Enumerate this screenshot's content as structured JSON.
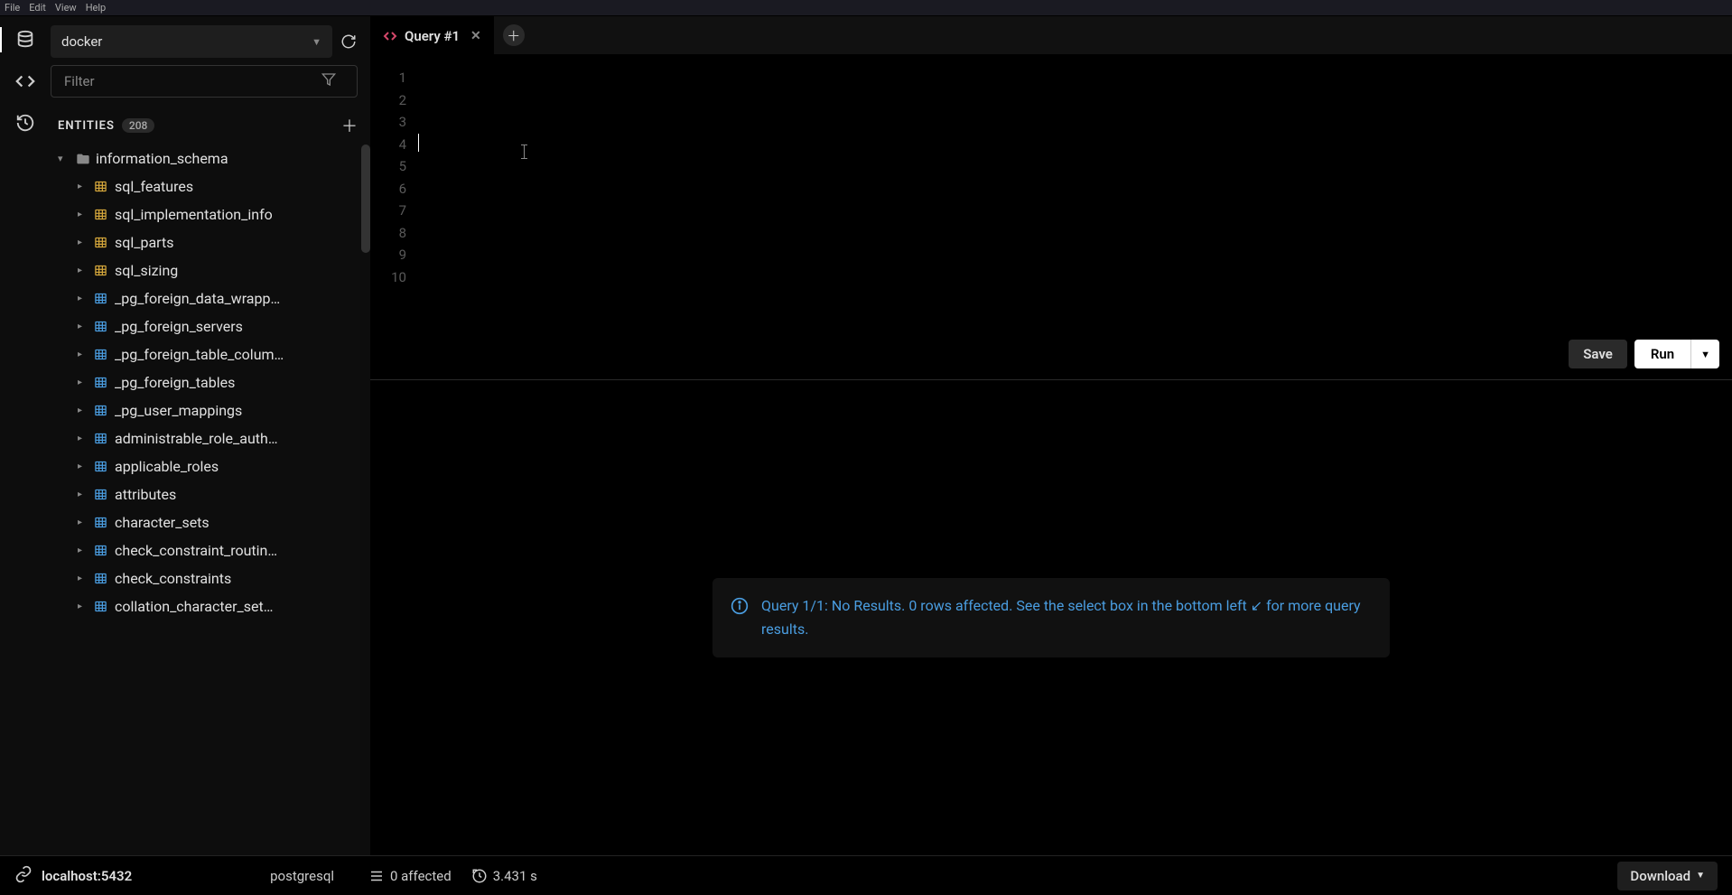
{
  "menubar": {
    "file": "File",
    "edit": "Edit",
    "view": "View",
    "help": "Help"
  },
  "connection": {
    "name": "docker"
  },
  "filter": {
    "placeholder": "Filter"
  },
  "entities": {
    "title": "ENTITIES",
    "count": "208"
  },
  "schema": {
    "name": "information_schema"
  },
  "tables": [
    {
      "name": "sql_features",
      "color": "yellow"
    },
    {
      "name": "sql_implementation_info",
      "color": "yellow"
    },
    {
      "name": "sql_parts",
      "color": "yellow"
    },
    {
      "name": "sql_sizing",
      "color": "yellow"
    },
    {
      "name": "_pg_foreign_data_wrapp…",
      "color": "blue"
    },
    {
      "name": "_pg_foreign_servers",
      "color": "blue"
    },
    {
      "name": "_pg_foreign_table_colum…",
      "color": "blue"
    },
    {
      "name": "_pg_foreign_tables",
      "color": "blue"
    },
    {
      "name": "_pg_user_mappings",
      "color": "blue"
    },
    {
      "name": "administrable_role_auth…",
      "color": "blue"
    },
    {
      "name": "applicable_roles",
      "color": "blue"
    },
    {
      "name": "attributes",
      "color": "blue"
    },
    {
      "name": "character_sets",
      "color": "blue"
    },
    {
      "name": "check_constraint_routin…",
      "color": "blue"
    },
    {
      "name": "check_constraints",
      "color": "blue"
    },
    {
      "name": "collation_character_set…",
      "color": "blue"
    }
  ],
  "tab": {
    "title": "Query #1"
  },
  "gutter": [
    "1",
    "2",
    "3",
    "4",
    "5",
    "6",
    "7",
    "8",
    "9",
    "10"
  ],
  "actions": {
    "save": "Save",
    "run": "Run"
  },
  "result_msg": "Query 1/1: No Results. 0 rows affected. See the select box in the bottom left ↙ for more query results.",
  "status": {
    "host": "localhost:5432",
    "db": "postgresql",
    "affected": "0 affected",
    "time": "3.431 s",
    "download": "Download"
  }
}
